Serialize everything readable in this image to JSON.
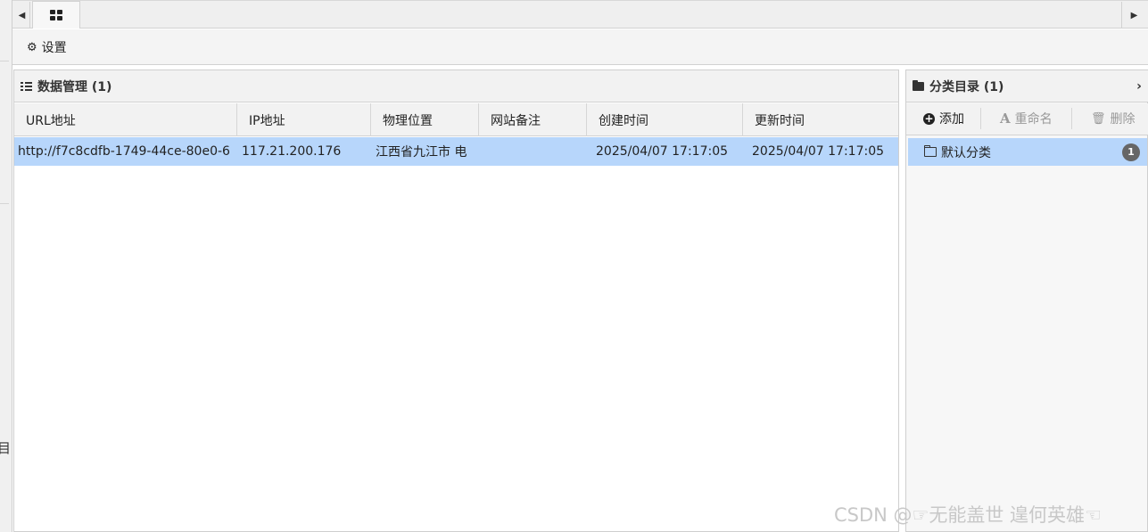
{
  "tabs": {
    "scroll_left_icon": "caret-left-icon",
    "home_icon": "th-large-icon",
    "scroll_right_icon": "caret-right-icon"
  },
  "toolbar": {
    "settings_label": "设置",
    "settings_icon": "gear-icon"
  },
  "data_panel": {
    "title": "数据管理 (1)",
    "columns": [
      "URL地址",
      "IP地址",
      "物理位置",
      "网站备注",
      "创建时间",
      "更新时间"
    ],
    "rows": [
      {
        "url": "http://f7c8cdfb-1749-44ce-80e0-6",
        "ip": "117.21.200.176",
        "location": "江西省九江市 电",
        "note": "",
        "created": "2025/04/07 17:17:05",
        "updated": "2025/04/07 17:17:05"
      }
    ]
  },
  "category_panel": {
    "title": "分类目录 (1)",
    "add_label": "添加",
    "rename_label": "重命名",
    "delete_label": "删除",
    "rename_glyph": "A",
    "items": [
      {
        "label": "默认分类",
        "count": "1"
      }
    ]
  },
  "left_stub": {
    "char": "目"
  },
  "watermark": "CSDN @☞无能盖世 遑何英雄☜",
  "colors": {
    "selection": "#b7d6fb",
    "header_bg": "#f2f2f2",
    "border": "#d2d2d2",
    "badge": "#666666",
    "disabled_text": "#999999"
  }
}
